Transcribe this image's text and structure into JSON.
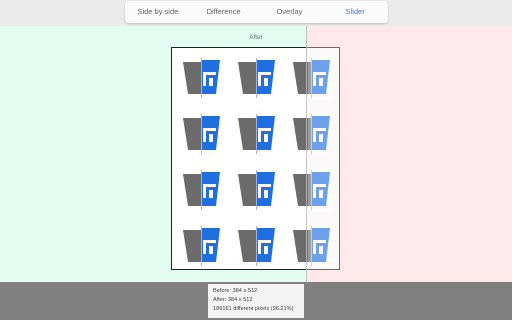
{
  "tabs": [
    {
      "label": "Side by side",
      "active": false
    },
    {
      "label": "Difference",
      "active": false
    },
    {
      "label": "Overlay",
      "active": false
    },
    {
      "label": "Slider",
      "active": true
    }
  ],
  "colors": {
    "accent": "#4a79d8",
    "left_background": "#e2fcf2",
    "right_background": "#fde9ec",
    "icon_gray": "#6b6b6b",
    "icon_blue": "#1f6fe0",
    "red_border": "#d03a4e"
  },
  "viewer": {
    "label": "After",
    "icon": "logo-tile-icon",
    "rows": 4,
    "cols": 3
  },
  "info": {
    "before": "Before: 384 x 512",
    "after": "After: 384 x 512",
    "diff": "189161 different pixels (96.21%)"
  }
}
